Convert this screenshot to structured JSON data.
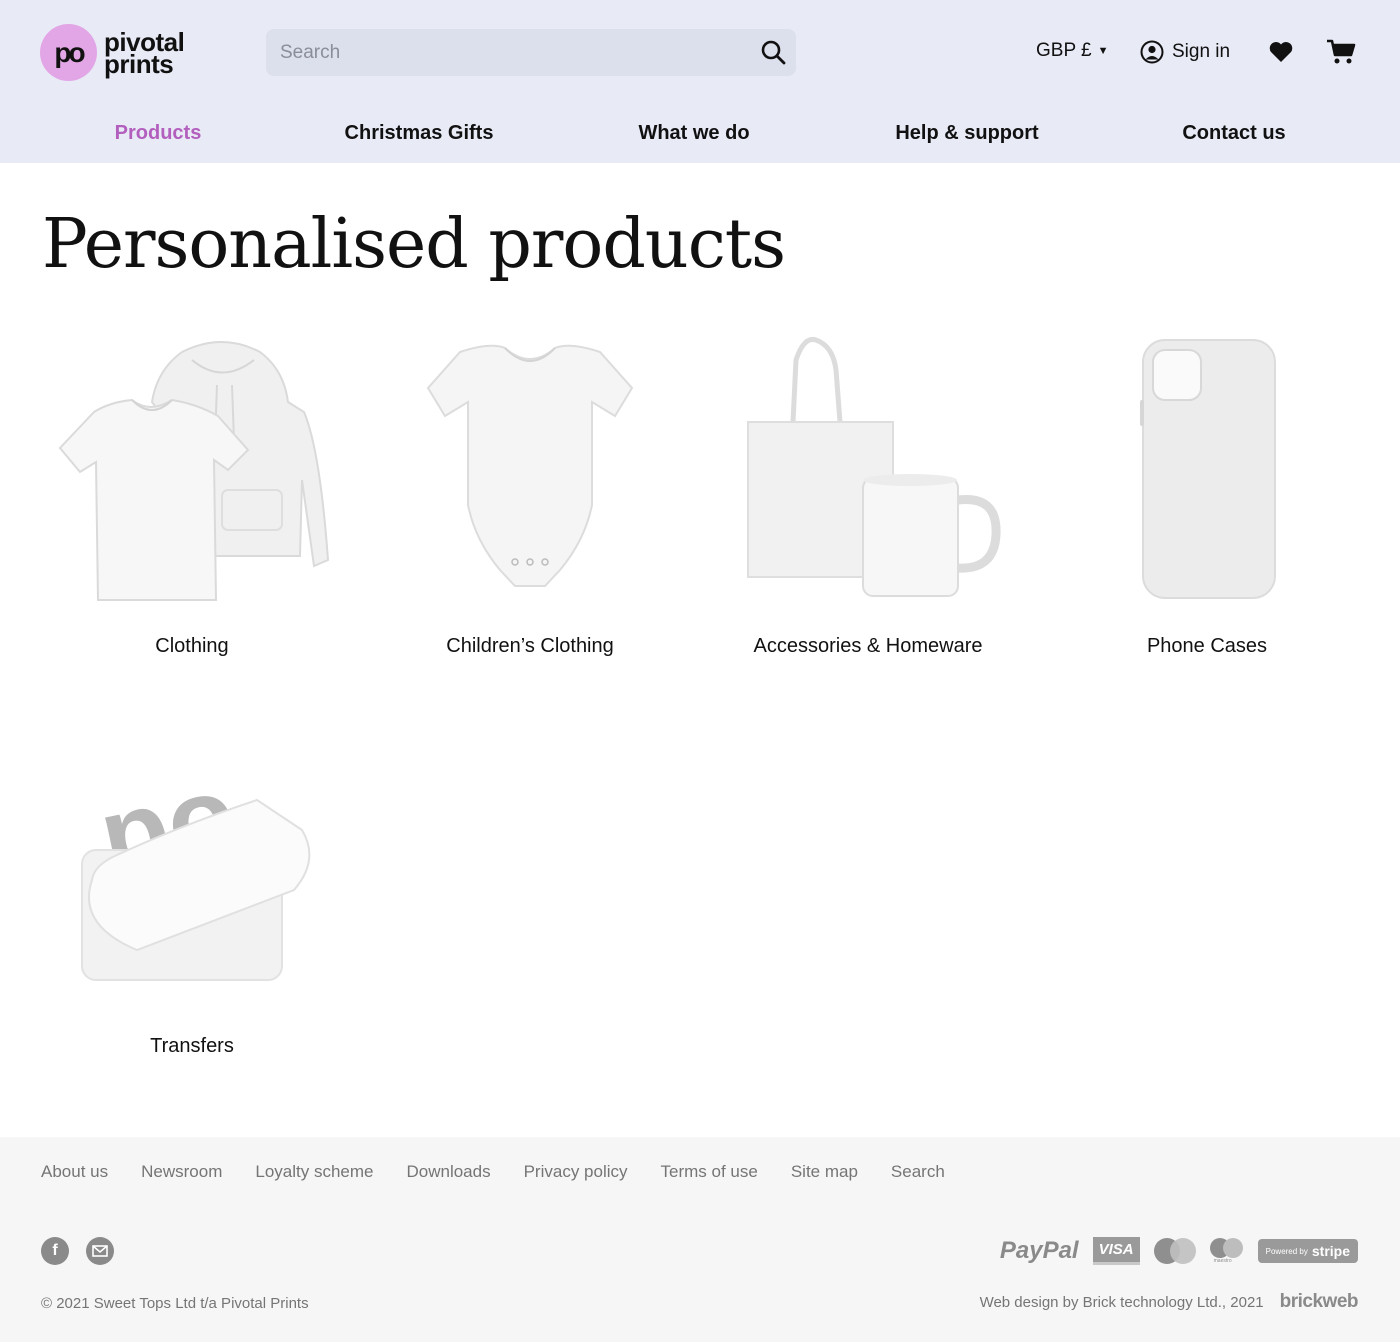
{
  "header": {
    "logo_mark": "po",
    "logo_line1": "pivotal",
    "logo_line2": "prints",
    "search_placeholder": "Search",
    "currency": "GBP £",
    "sign_in": "Sign in",
    "accent_color": "#b35fbe",
    "logo_color": "#e2a6e6",
    "background_color": "#e8eaf6"
  },
  "nav": {
    "items": [
      {
        "label": "Products",
        "active": true
      },
      {
        "label": "Christmas Gifts"
      },
      {
        "label": "What we do"
      },
      {
        "label": "Help & support"
      },
      {
        "label": "Contact us"
      }
    ]
  },
  "main": {
    "title": "Personalised products",
    "categories": [
      {
        "label": "Clothing",
        "icon": "tshirt-hoodie-image"
      },
      {
        "label": "Children’s Clothing",
        "icon": "baby-bodysuit-image"
      },
      {
        "label": "Accessories & Homeware",
        "icon": "tote-bag-mug-image"
      },
      {
        "label": "Phone Cases",
        "icon": "phone-case-image"
      },
      {
        "label": "Transfers",
        "icon": "transfer-sheet-image"
      }
    ]
  },
  "footer": {
    "links": [
      "About us",
      "Newsroom",
      "Loyalty scheme",
      "Downloads",
      "Privacy policy",
      "Terms of use",
      "Site map",
      "Search"
    ],
    "social": [
      "facebook-icon",
      "email-icon"
    ],
    "payments": {
      "paypal": "PayPal",
      "visa": "VISA",
      "maestro": "maestro",
      "stripe_prefix": "Powered by",
      "stripe": "stripe"
    },
    "copyright": "© 2021 Sweet Tops Ltd t/a Pivotal Prints",
    "credit": "Web design by Brick technology Ltd., 2021",
    "credit_logo": "brickweb"
  }
}
